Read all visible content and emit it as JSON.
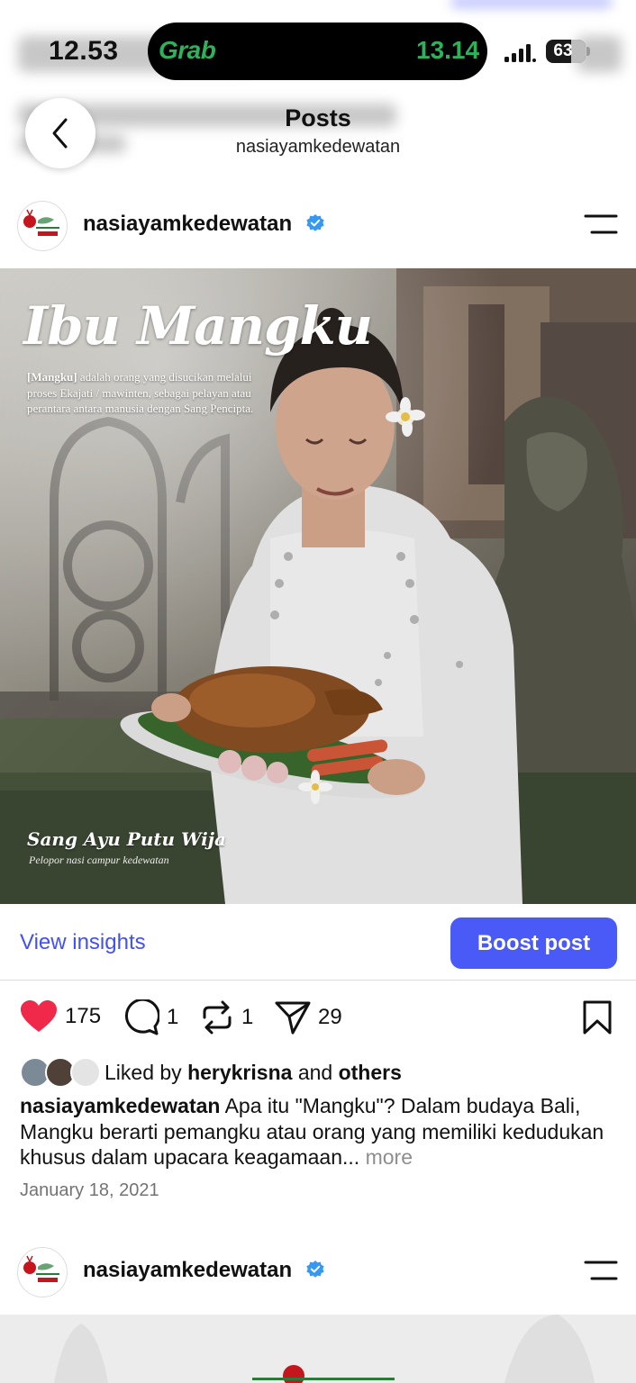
{
  "status_bar": {
    "time": "12.53",
    "live_activity_brand": "Grab",
    "live_activity_time": "13.14",
    "battery_level": 63
  },
  "header": {
    "title": "Posts",
    "subtitle": "nasiayamkedewatan"
  },
  "post": {
    "username": "nasiayamkedewatan",
    "verified": true,
    "image": {
      "title": "Ibu Mangku",
      "description_bold": "[Mangku]",
      "description_rest": " adalah orang yang disucikan melalui proses Ekajati / mawinten, sebagai pelayan atau perantara antara manusia dengan Sang Pencipta.",
      "signature": "Sang Ayu Putu Wija",
      "signature_caption": "Pelopor nasi campur kedewatan"
    },
    "view_insights_label": "View insights",
    "boost_label": "Boost post",
    "likes": "175",
    "comments": "1",
    "reposts": "1",
    "shares": "29",
    "liked_by_prefix": "Liked by",
    "liked_by_user": "herykrisna",
    "liked_by_and": "and",
    "liked_by_others": "others",
    "caption_username": "nasiayamkedewatan",
    "caption_text": " Apa itu \"Mangku\"? Dalam budaya Bali, Mangku berarti pemangku atau orang yang memiliki kedudukan khusus dalam upacara keagamaan...",
    "more_label": " more",
    "date": "January 18, 2021"
  },
  "next_post": {
    "username": "nasiayamkedewatan",
    "verified": true
  },
  "colors": {
    "accent_blue": "#4a5af7",
    "link_blue": "#4150f7",
    "like_red": "#f02849",
    "verified_blue": "#3897f0",
    "grab_green": "#2fb15b"
  }
}
